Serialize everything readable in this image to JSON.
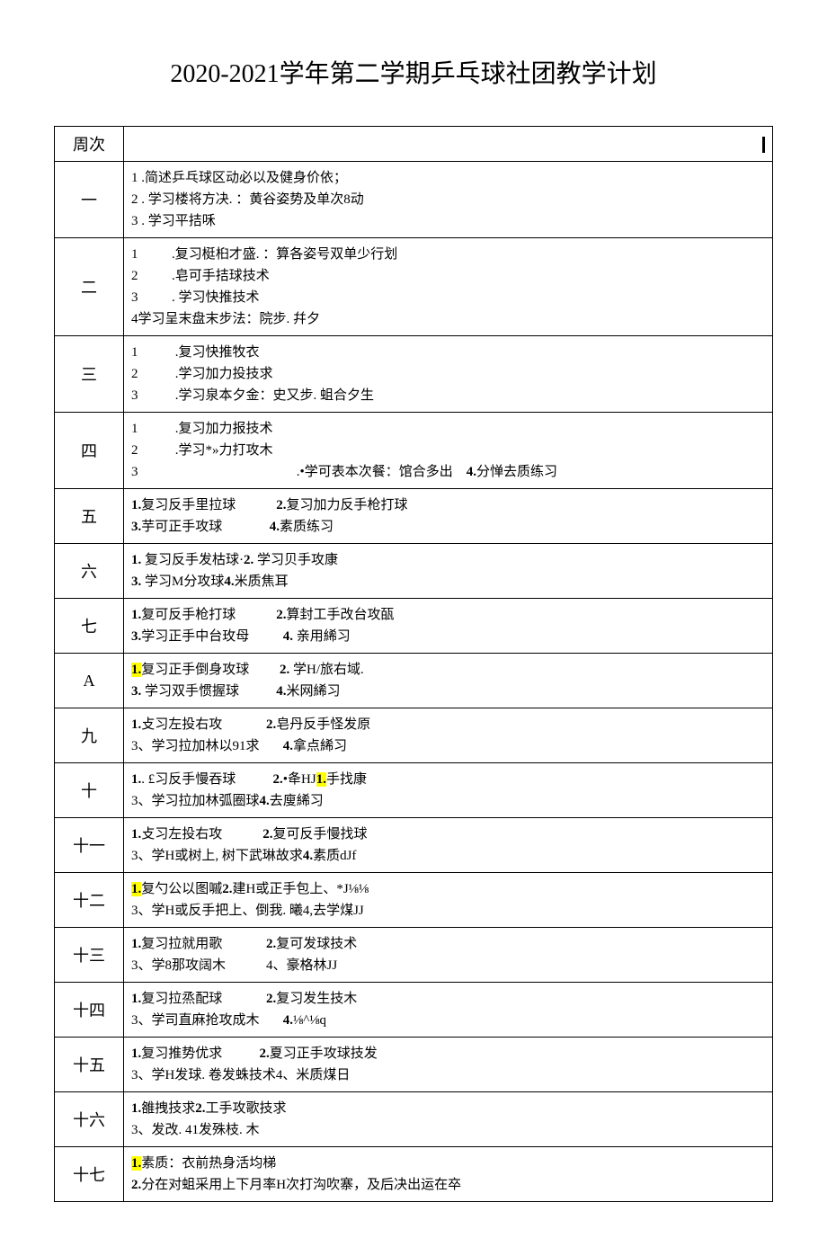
{
  "title": "2020-2021学年第二学期乒乓球社团教学计划",
  "header": {
    "week": "周次"
  },
  "rows": [
    {
      "week": "一",
      "lines": [
        "1 .简述乒乓球区动必以及健身价依；",
        "2 . 学习楼将方决. ：黄谷姿势及单次8动",
        "3 . 学习平拮咊"
      ]
    },
    {
      "week": "二",
      "lines": [
        "1          .复习梃桕才盛. ：算各姿号双单少行划",
        "2          .皂可手拮球技术",
        "3          . 学习快推技术",
        "4学习呈末盘末步法：院步. 幷夕"
      ]
    },
    {
      "week": "三",
      "lines": [
        "1           .复习快推牧衣",
        "2           .学习加力投技求",
        "3           .学习泉本夕金：史又步. 蛆合夕生"
      ]
    },
    {
      "week": "四",
      "lines": [
        "1           .复习加力报技术",
        "2           .学习*»力打攻木",
        "3                                               .•学可表本次餐：馆合多出    4.分惮去质练习"
      ]
    },
    {
      "week": "五",
      "lines": [
        "1.复习反手里拉球            2.复习加力反手枪打球",
        "3.芋可正手攻球              4.素质练习"
      ]
    },
    {
      "week": "六",
      "lines": [
        "1. 复习反手发枯球·2. 学习贝手攻康",
        "3. 学习M分攻球4.米质焦耳"
      ]
    },
    {
      "week": "七",
      "lines": [
        "1.复可反手枪打球            2.算封工手改台攻㼣",
        "3.学习正手中台玫母          4. 亲用絺习"
      ]
    },
    {
      "week": "A",
      "lines": [
        "<hl>1.</hl>复习正手倒身攻球         2. 学H/旅右域.",
        "3. 学习双手惯握球           4.米网絺习"
      ]
    },
    {
      "week": "九",
      "lines": [
        "1.攴习左投右攻             2.皂丹反手怪发原",
        "3、学习拉加林以91求       4.拿点絺习"
      ]
    },
    {
      "week": "十",
      "lines": [
        "1.. £习反手慢吞球           2.•夅HJ<hl>1.</hl>手找康",
        "3、学习拉加林弧圈球4.去廋絺习"
      ]
    },
    {
      "week": "十一",
      "lines": [
        "1.攴习左投右攻            2.复可反手慢找球",
        "3、学H或树上, 树下武琳故求4.素质dJf"
      ]
    },
    {
      "week": "十二",
      "lines": [
        "<hl>1.</hl>复勺公以图嘁2.建H或正手包上、*J⅛⅛",
        "3、学H或反手把上、倒我. 曦4,去学煤JJ"
      ]
    },
    {
      "week": "十三",
      "lines": [
        "1.复习拉就用歌             2.复可发球技术",
        "3、学8那攻阔木            4、豪格林JJ"
      ]
    },
    {
      "week": "十四",
      "lines": [
        "1.复习拉烝配球             2.复习发生技木",
        "3、学司直麻抢攻成木       4.⅛^⅛q"
      ]
    },
    {
      "week": "十五",
      "lines": [
        "1.复习推势优求           2.夏习正手攻球技发",
        "3、学H发球. 卷发蛛技术4、米质煤日"
      ]
    },
    {
      "week": "十六",
      "lines": [
        "1.雒拽技求2.工手攻歌技求",
        "3、发改. 41发殊枝. 木"
      ]
    },
    {
      "week": "十七",
      "lines": [
        "<hl>1.</hl>素质：衣前热身活均梯",
        "2.分在对蛆采用上下月率H次打沟吹寨，及后决出运在卒"
      ]
    }
  ]
}
